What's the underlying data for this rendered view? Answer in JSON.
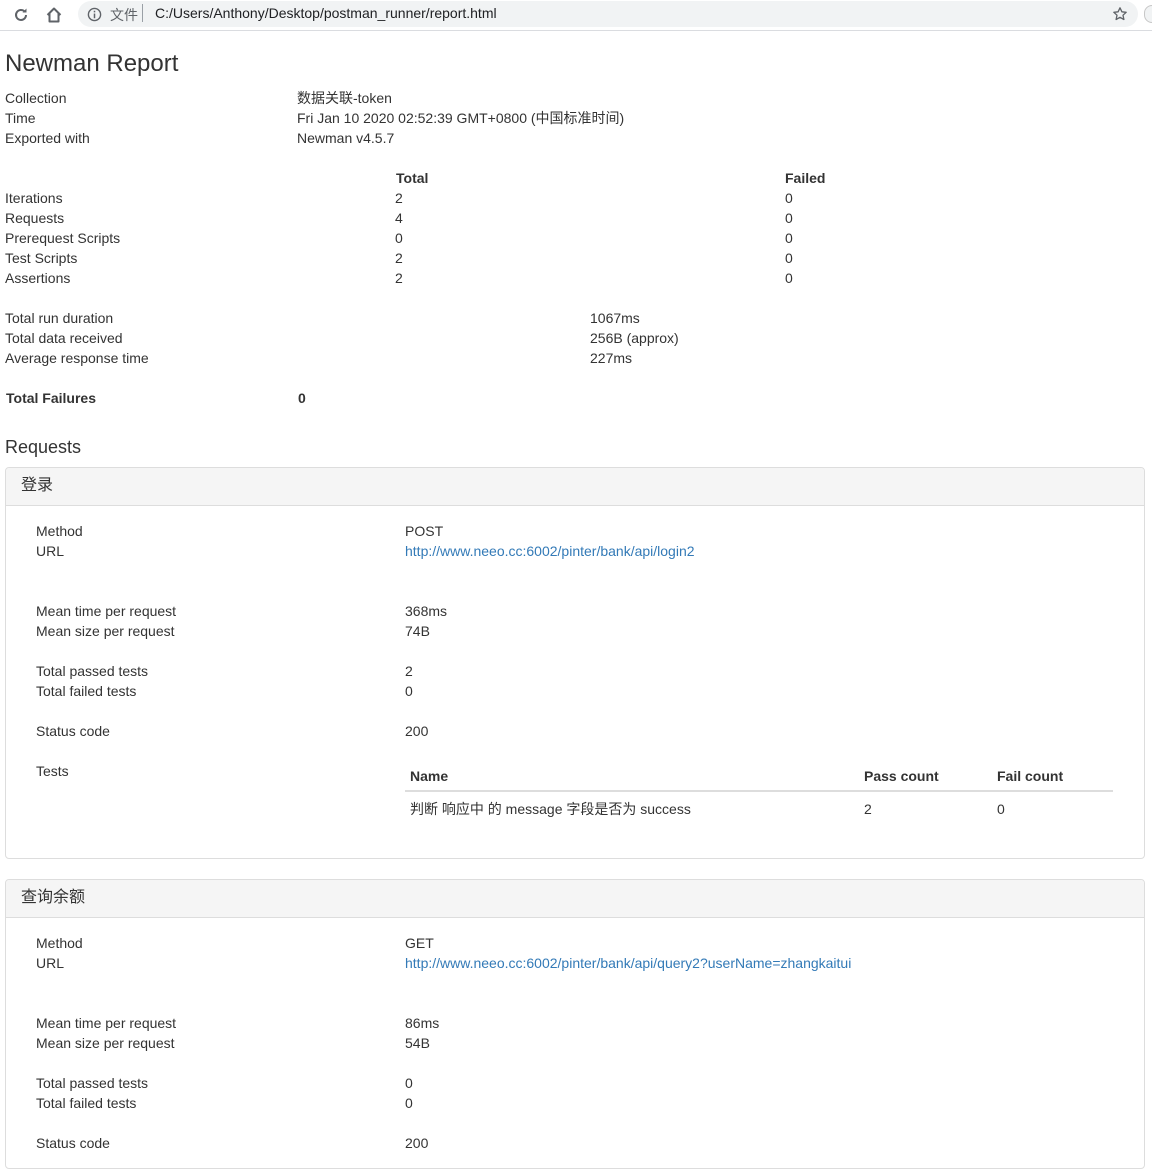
{
  "browser": {
    "scheme_label": "文件",
    "address": "C:/Users/Anthony/Desktop/postman_runner/report.html"
  },
  "report": {
    "title": "Newman Report",
    "meta": [
      {
        "label": "Collection",
        "value": "数据关联-token"
      },
      {
        "label": "Time",
        "value": "Fri Jan 10 2020 02:52:39 GMT+0800 (中国标准时间)"
      },
      {
        "label": "Exported with",
        "value": "Newman v4.5.7"
      }
    ],
    "summary_headers": {
      "total": "Total",
      "failed": "Failed"
    },
    "summary": [
      {
        "label": "Iterations",
        "total": "2",
        "failed": "0"
      },
      {
        "label": "Requests",
        "total": "4",
        "failed": "0"
      },
      {
        "label": "Prerequest Scripts",
        "total": "0",
        "failed": "0"
      },
      {
        "label": "Test Scripts",
        "total": "2",
        "failed": "0"
      },
      {
        "label": "Assertions",
        "total": "2",
        "failed": "0"
      }
    ],
    "timings": [
      {
        "label": "Total run duration",
        "value": "1067ms"
      },
      {
        "label": "Total data received",
        "value": "256B (approx)"
      },
      {
        "label": "Average response time",
        "value": "227ms"
      }
    ],
    "total_failures": {
      "label": "Total Failures",
      "value": "0"
    }
  },
  "requests_title": "Requests",
  "field_labels": {
    "method": "Method",
    "url": "URL",
    "mean_time": "Mean time per request",
    "mean_size": "Mean size per request",
    "passed": "Total passed tests",
    "failed": "Total failed tests",
    "status": "Status code",
    "tests": "Tests"
  },
  "tests_headers": {
    "name": "Name",
    "pass": "Pass count",
    "fail": "Fail count"
  },
  "requests": [
    {
      "name": "登录",
      "method": "POST",
      "url": "http://www.neeo.cc:6002/pinter/bank/api/login2",
      "mean_time": "368ms",
      "mean_size": "74B",
      "passed": "2",
      "failed": "0",
      "status": "200",
      "tests": [
        {
          "name": "判断 响应中 的 message 字段是否为 success",
          "pass": "2",
          "fail": "0"
        }
      ]
    },
    {
      "name": "查询余额",
      "method": "GET",
      "url": "http://www.neeo.cc:6002/pinter/bank/api/query2?userName=zhangkaitui",
      "mean_time": "86ms",
      "mean_size": "54B",
      "passed": "0",
      "failed": "0",
      "status": "200"
    }
  ]
}
